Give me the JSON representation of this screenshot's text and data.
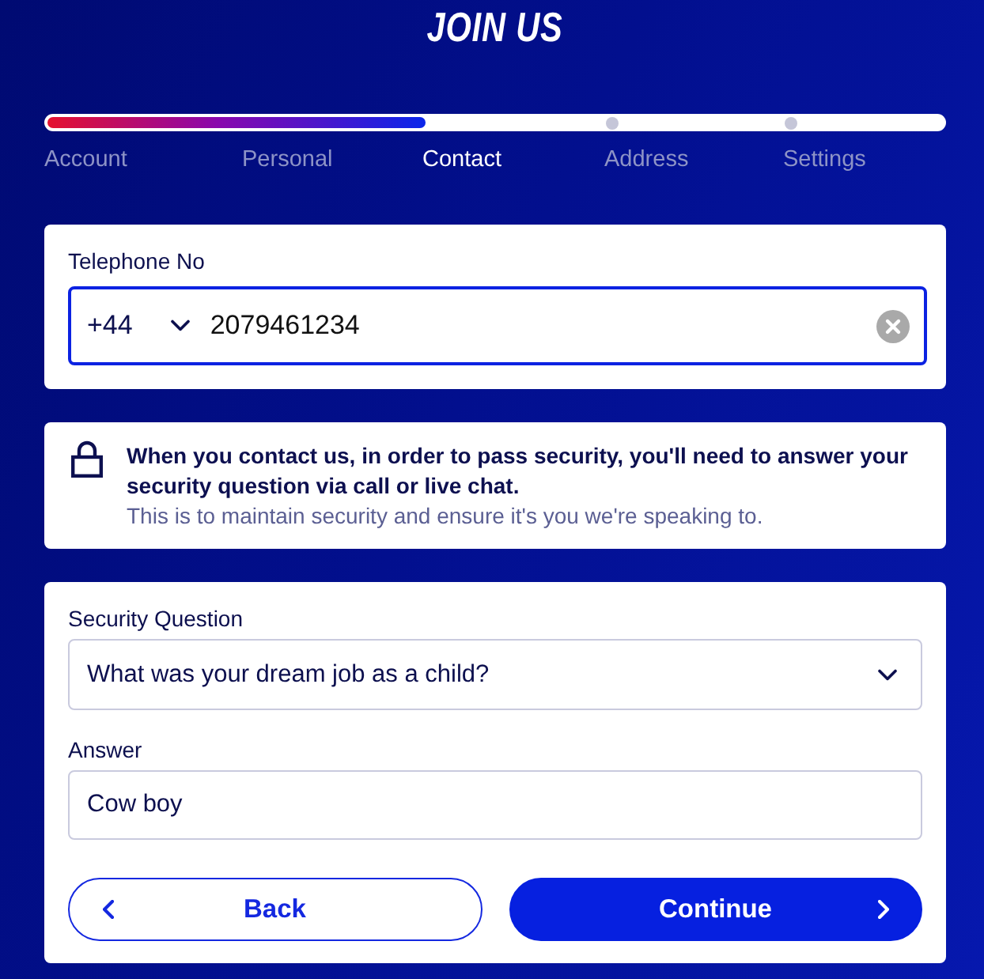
{
  "title": "JOIN US",
  "progress": {
    "level": 0.42,
    "steps": [
      {
        "label": "Account",
        "selected": false
      },
      {
        "label": "Personal",
        "selected": false
      },
      {
        "label": "Contact",
        "selected": true
      },
      {
        "label": "Address",
        "selected": false
      },
      {
        "label": "Settings",
        "selected": false
      }
    ]
  },
  "telephone": {
    "label": "Telephone No",
    "country_code": "+44",
    "value": "2079461234",
    "focused": true
  },
  "notice": {
    "heading": "When you contact us, in order to pass security, you'll need to answer your security question via call or live chat.",
    "body": "This is to maintain security and ensure it's you we're speaking to."
  },
  "security": {
    "question_label": "Security Question",
    "question": "What was your dream job as a child?",
    "answer_label": "Answer",
    "answer": "Cow boy"
  },
  "buttons": [
    {
      "label": "Back",
      "kind": "secondary"
    },
    {
      "label": "Continue",
      "kind": "primary"
    }
  ]
}
